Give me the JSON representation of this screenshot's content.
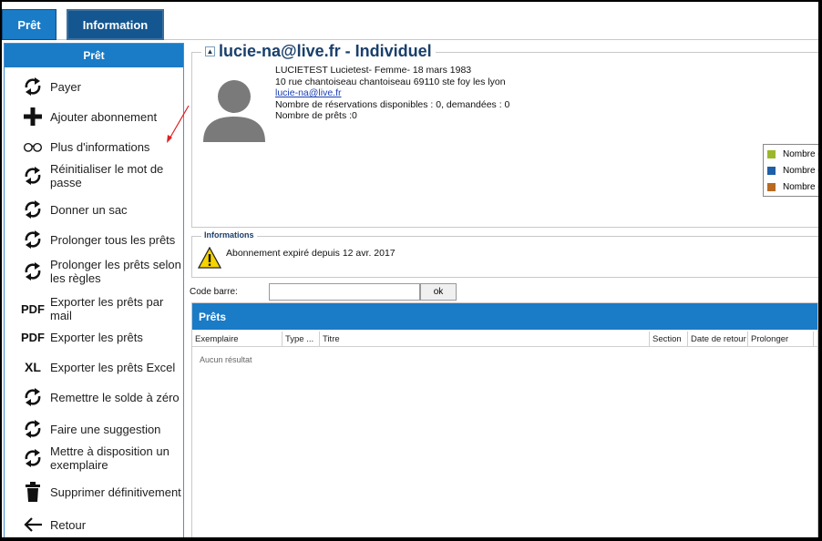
{
  "tabs": {
    "pret": "Prêt",
    "information": "Information"
  },
  "sidebar": {
    "header": "Prêt",
    "items": [
      {
        "label": "Payer",
        "icon": "refresh-icon"
      },
      {
        "label": "Ajouter abonnement",
        "icon": "plus-icon"
      },
      {
        "label": "Plus d'informations",
        "icon": "glasses-icon"
      },
      {
        "label": "Réinitialiser le mot de passe",
        "icon": "refresh-icon"
      },
      {
        "label": "Donner un sac",
        "icon": "refresh-icon"
      },
      {
        "label": "Prolonger tous les prêts",
        "icon": "refresh-icon"
      },
      {
        "label": "Prolonger les prêts selon les règles",
        "icon": "refresh-icon"
      },
      {
        "label": "Exporter les prêts par mail",
        "icon": "pdf-icon",
        "glyph": "PDF"
      },
      {
        "label": "Exporter les prêts",
        "icon": "pdf-icon",
        "glyph": "PDF"
      },
      {
        "label": "Exporter les prêts Excel",
        "icon": "excel-icon",
        "glyph": "XL"
      },
      {
        "label": "Remettre le solde à zéro",
        "icon": "refresh-icon"
      },
      {
        "label": "Faire une suggestion",
        "icon": "refresh-icon"
      },
      {
        "label": "Mettre à disposition un exemplaire",
        "icon": "refresh-icon"
      },
      {
        "label": "Supprimer définitivement",
        "icon": "trash-icon"
      },
      {
        "label": "Retour",
        "icon": "arrow-left-icon"
      }
    ]
  },
  "patron": {
    "title": "lucie-na@live.fr - Individuel",
    "line1": "LUCIETEST Lucietest- Femme- 18 mars 1983",
    "address": "10 rue chantoiseau chantoiseau 69110 ste foy les lyon",
    "email": "lucie-na@live.fr",
    "reservations": "Nombre de réservations disponibles : 0, demandées : 0",
    "loans": "Nombre de prêts :0"
  },
  "legend": [
    {
      "label": "Nombre de",
      "color": "#9bb82a"
    },
    {
      "label": "Nombre de",
      "color": "#1e5fa8"
    },
    {
      "label": "Nombre de",
      "color": "#b86a22"
    }
  ],
  "info": {
    "title": "Informations",
    "message": "Abonnement expiré depuis 12 avr. 2017"
  },
  "barcode": {
    "label": "Code barre:",
    "value": "",
    "button": "ok"
  },
  "loans_table": {
    "title": "Prêts",
    "columns": [
      "Exemplaire",
      "Type ...",
      "Titre",
      "Section",
      "Date de retour",
      "Prolonger"
    ],
    "empty": "Aucun résultat"
  }
}
